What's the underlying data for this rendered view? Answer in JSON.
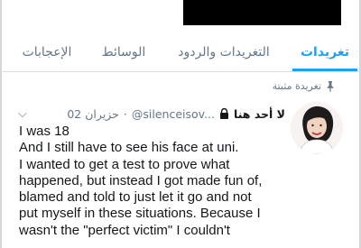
{
  "tabs": [
    {
      "label": "تغريدات",
      "active": true
    },
    {
      "label": "التغريدات والردود",
      "active": false
    },
    {
      "label": "الوسائط",
      "active": false
    },
    {
      "label": "الإعجابات",
      "active": false
    }
  ],
  "pinned": {
    "label": "تغريدة مثبتة",
    "icon": "pin-icon"
  },
  "tweet": {
    "display_name": "لا أحد هنا",
    "handle": "@silenceisov...",
    "date": "02 حزيران",
    "lines": [
      "I was 18",
      "And I still have to see his face at uni.",
      "I wanted to get a test to prove what",
      "happened, but instead I got made fun of,",
      "blamed and told to just let it go and not",
      "put myself in these situations. Because I",
      "wasn't the \"perfect victim\" I couldn't"
    ]
  },
  "colors": {
    "accent": "#1da1f2",
    "muted": "#657786",
    "text": "#14171a"
  }
}
